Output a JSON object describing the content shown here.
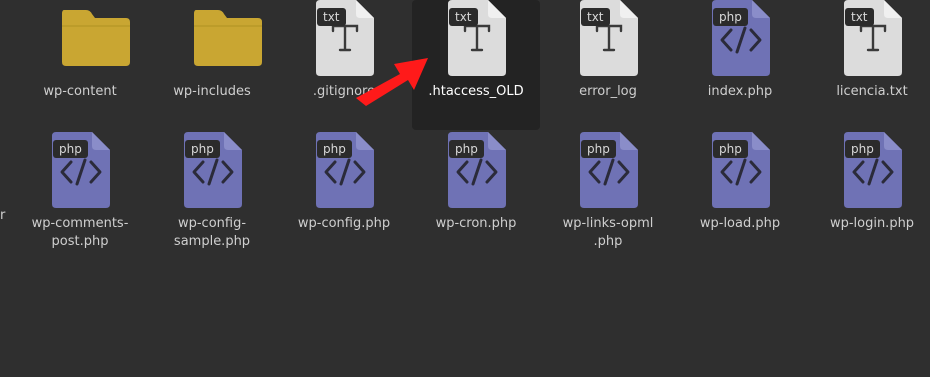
{
  "colors": {
    "background": "#2f2f2f",
    "selected_background": "#232323",
    "folder": "#c9a632",
    "txt_doc": "#dcdcdc",
    "php_doc": "#6f72b5",
    "annotation_arrow": "#ff1a1a"
  },
  "files": [
    {
      "name": "wp-content",
      "kind": "folder",
      "icon": "folder-icon",
      "badge": ""
    },
    {
      "name": "wp-includes",
      "kind": "folder",
      "icon": "folder-icon",
      "badge": ""
    },
    {
      "name": ".gitignore",
      "kind": "txt",
      "icon": "text-file-icon",
      "badge": "txt"
    },
    {
      "name": ".htaccess_OLD",
      "kind": "txt",
      "icon": "text-file-icon",
      "badge": "txt",
      "selected": true
    },
    {
      "name": "error_log",
      "kind": "txt",
      "icon": "text-file-icon",
      "badge": "txt"
    },
    {
      "name": "index.php",
      "kind": "php",
      "icon": "code-file-icon",
      "badge": "php"
    },
    {
      "name": "licencia.txt",
      "kind": "txt",
      "icon": "text-file-icon",
      "badge": "txt"
    },
    {
      "name": "wp-comments-\npost.php",
      "kind": "php",
      "icon": "code-file-icon",
      "badge": "php"
    },
    {
      "name": "wp-config-\nsample.php",
      "kind": "php",
      "icon": "code-file-icon",
      "badge": "php"
    },
    {
      "name": "wp-config.php",
      "kind": "php",
      "icon": "code-file-icon",
      "badge": "php"
    },
    {
      "name": "wp-cron.php",
      "kind": "php",
      "icon": "code-file-icon",
      "badge": "php"
    },
    {
      "name": "wp-links-opml\n.php",
      "kind": "php",
      "icon": "code-file-icon",
      "badge": "php"
    },
    {
      "name": "wp-load.php",
      "kind": "php",
      "icon": "code-file-icon",
      "badge": "php"
    },
    {
      "name": "wp-login.php",
      "kind": "php",
      "icon": "code-file-icon",
      "badge": "php"
    }
  ],
  "annotation": {
    "icon": "red-arrow-icon"
  },
  "cut_off_label": "r"
}
